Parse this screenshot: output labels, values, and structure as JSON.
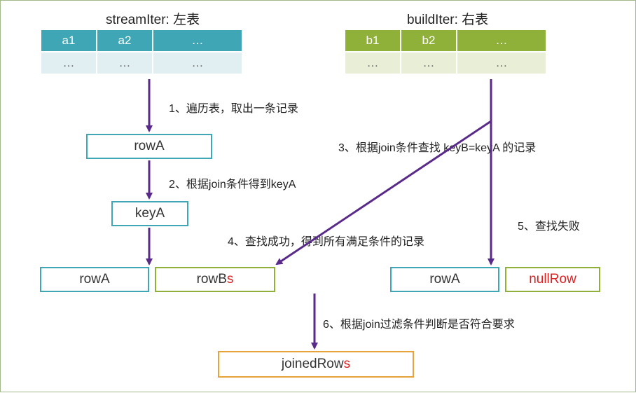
{
  "titles": {
    "left": "streamIter: 左表",
    "right": "buildIter: 右表"
  },
  "leftTable": {
    "headers": [
      "a1",
      "a2",
      "…"
    ],
    "row": [
      "…",
      "…",
      "…"
    ]
  },
  "rightTable": {
    "headers": [
      "b1",
      "b2",
      "…"
    ],
    "row": [
      "…",
      "…",
      "…"
    ]
  },
  "boxes": {
    "rowA1": "rowA",
    "keyA": "keyA",
    "rowA2": "rowA",
    "rowBs_prefix": "rowB",
    "rowBs_suffix": "s",
    "rowA3": "rowA",
    "nullRow": "nullRow",
    "joinedRows_prefix": "joinedRow",
    "joinedRows_suffix": "s"
  },
  "steps": {
    "s1": "1、遍历表，取出一条记录",
    "s2": "2、根据join条件得到keyA",
    "s3": "3、根据join条件查找 keyB=keyA 的记录",
    "s4": "4、查找成功，得到所有满足条件的记录",
    "s5": "5、查找失败",
    "s6": "6、根据join过滤条件判断是否符合要求"
  },
  "colors": {
    "teal": "#3fa6b5",
    "green": "#8fb13a",
    "orange": "#e8a23a",
    "purple": "#5a2a8a",
    "red": "#d22"
  }
}
